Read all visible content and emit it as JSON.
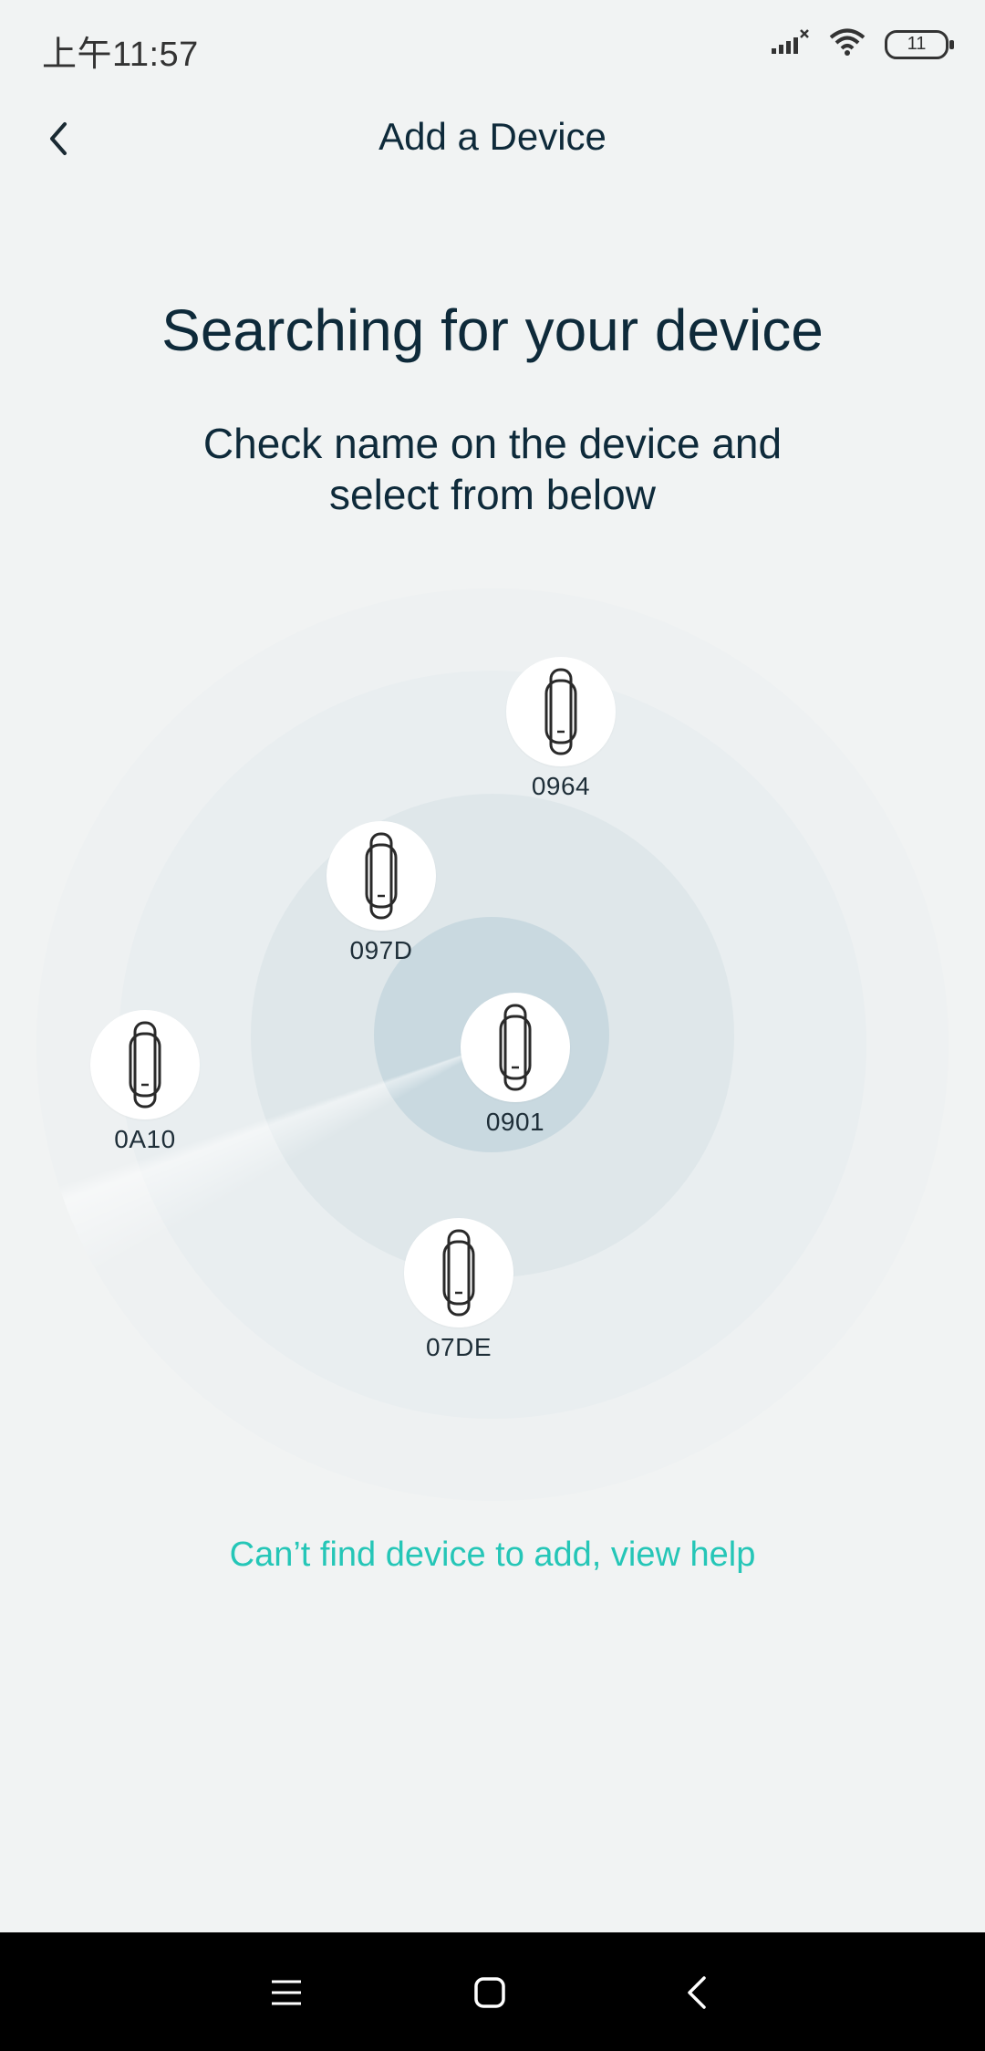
{
  "status_bar": {
    "time": "上午11:57",
    "battery": "11",
    "icons": [
      "signal-icon",
      "wifi-icon",
      "battery-icon"
    ]
  },
  "header": {
    "title": "Add a Device",
    "back_icon": "chevron-left-icon"
  },
  "main": {
    "title": "Searching for your device",
    "subtitle": "Check name on the device and select from below"
  },
  "devices": [
    {
      "label": "0964",
      "icon": "band-icon"
    },
    {
      "label": "097D",
      "icon": "band-icon"
    },
    {
      "label": "0A10",
      "icon": "band-icon"
    },
    {
      "label": "0901",
      "icon": "band-icon"
    },
    {
      "label": "07DE",
      "icon": "band-icon"
    }
  ],
  "help": {
    "text": "Can’t find device to add, view help"
  },
  "nav_bar": {
    "buttons": [
      "menu-icon",
      "home-icon",
      "back-icon"
    ]
  },
  "colors": {
    "background": "#f1f3f3",
    "accent": "#25c6b7",
    "text": "#0e2a3a"
  }
}
